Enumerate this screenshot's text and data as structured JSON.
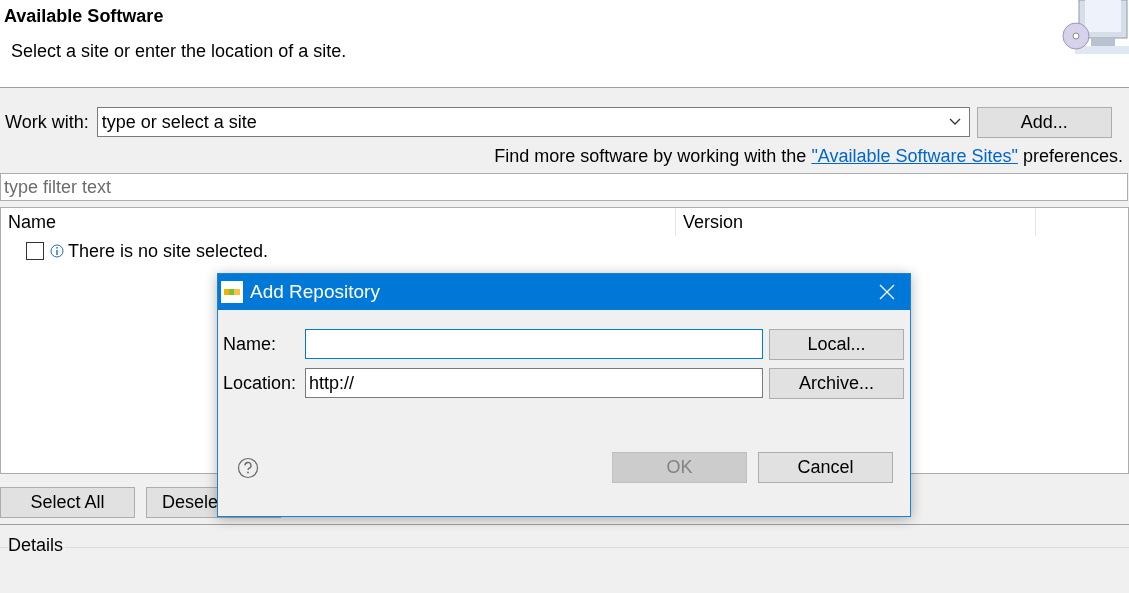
{
  "header": {
    "title": "Available Software",
    "subtitle": "Select a site or enter the location of a site."
  },
  "work_with": {
    "label": "Work with:",
    "value": "type or select a site",
    "button": "Add..."
  },
  "hint": {
    "before": "Find more software by working with the",
    "link": "\"Available Software Sites\"",
    "after": "preferences."
  },
  "filter": {
    "placeholder": "type filter text"
  },
  "table": {
    "columns": [
      "Name",
      "Version"
    ],
    "rows": [
      {
        "checked": false,
        "text": "There is no site selected."
      }
    ]
  },
  "buttons": [
    "Select All",
    "Desele"
  ],
  "details": {
    "label": "Details"
  },
  "dialog": {
    "title": "Add Repository",
    "fields": [
      {
        "label": "Name:",
        "focused": true,
        "button": "Local..."
      },
      {
        "label": "Location:",
        "value": "http://",
        "focused": false,
        "button": "Archive..."
      }
    ],
    "buttons": [
      {
        "label": "OK",
        "disabled": true
      },
      {
        "label": "Cancel",
        "disabled": false
      }
    ]
  }
}
